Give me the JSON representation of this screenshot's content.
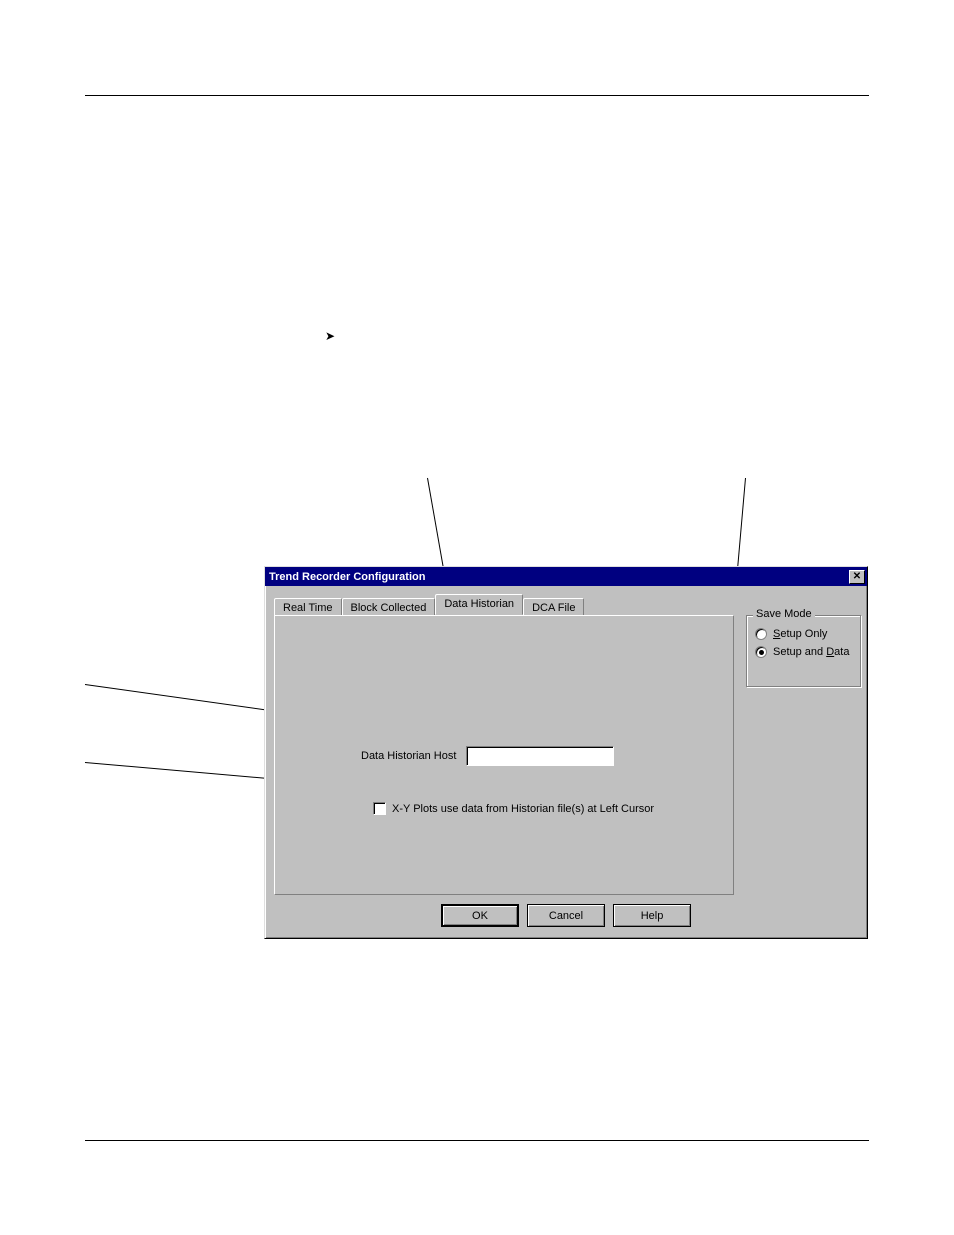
{
  "dialog": {
    "title": "Trend Recorder Configuration",
    "tabs": [
      {
        "label": "Real Time"
      },
      {
        "label": "Block Collected"
      },
      {
        "label": "Data Historian"
      },
      {
        "label": "DCA File"
      }
    ],
    "active_tab": 2,
    "data_historian": {
      "host_label": "Data Historian Host",
      "host_value": "",
      "xy_checkbox_label": "X-Y Plots use data from Historian file(s) at Left Cursor",
      "xy_checked": false
    },
    "save_mode": {
      "legend": "Save Mode",
      "options": [
        {
          "label_pre": "",
          "accel": "S",
          "label_post": "etup Only",
          "checked": false
        },
        {
          "label_pre": "Setup and ",
          "accel": "D",
          "label_post": "ata",
          "checked": true
        }
      ]
    },
    "buttons": {
      "ok": "OK",
      "cancel": "Cancel",
      "help": "Help"
    }
  },
  "glyphs": {
    "arrow": "➤"
  }
}
